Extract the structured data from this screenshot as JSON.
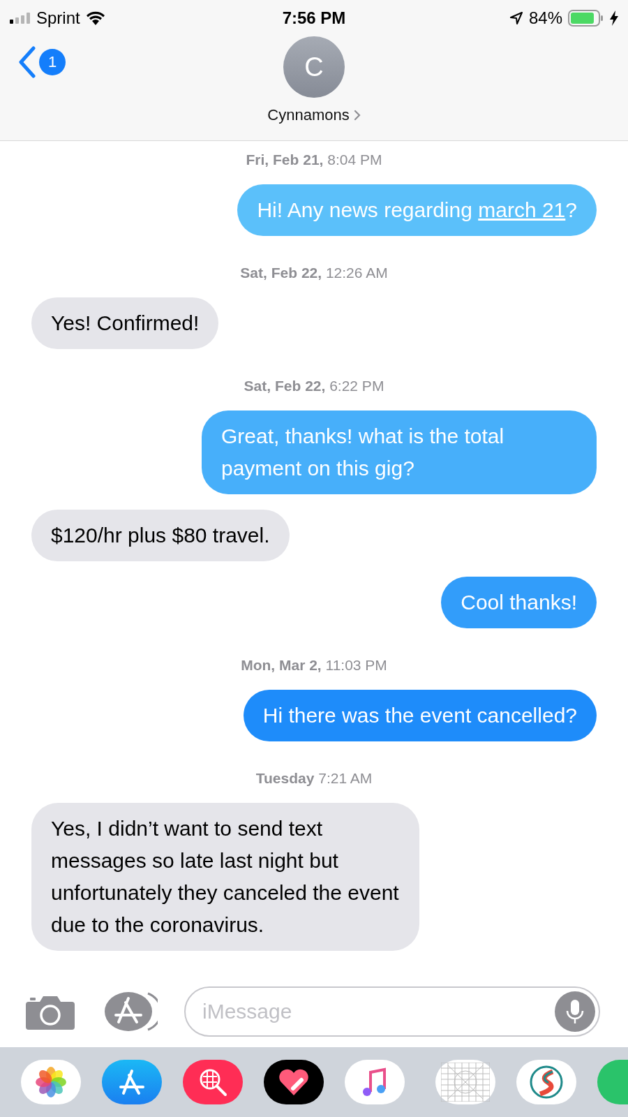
{
  "status_bar": {
    "carrier": "Sprint",
    "time": "7:56 PM",
    "battery": "84%"
  },
  "header": {
    "back_badge": "1",
    "avatar_letter": "C",
    "contact_name": "Cynnamons"
  },
  "conversation": [
    {
      "kind": "timestamp",
      "text": "**Fri, Feb 21,** 8:04 PM"
    },
    {
      "kind": "sent",
      "parts": [
        {
          "kind": "plain",
          "text": "Hi! Any news regarding "
        },
        {
          "kind": "link",
          "text": "march 21"
        },
        {
          "kind": "plain",
          "text": "?"
        }
      ]
    },
    {
      "kind": "timestamp",
      "text": "**Sat, Feb 22,** 12:26 AM"
    },
    {
      "kind": "received",
      "parts": [
        {
          "kind": "plain",
          "text": "Yes! Confirmed!"
        }
      ]
    },
    {
      "kind": "timestamp",
      "text": "**Sat, Feb 22,** 6:22 PM"
    },
    {
      "kind": "sent",
      "parts": [
        {
          "kind": "plain",
          "text": "Great, thanks! what is the total payment on this gig?"
        }
      ]
    },
    {
      "kind": "received",
      "parts": [
        {
          "kind": "plain",
          "text": "$120/hr plus $80 travel."
        }
      ]
    },
    {
      "kind": "sent",
      "parts": [
        {
          "kind": "plain",
          "text": "Cool thanks!"
        }
      ]
    },
    {
      "kind": "timestamp",
      "text": "**Mon, Mar 2,** 11:03 PM"
    },
    {
      "kind": "sent",
      "parts": [
        {
          "kind": "plain",
          "text": "Hi there was the event cancelled?"
        }
      ]
    },
    {
      "kind": "timestamp",
      "text": "**Tuesday** 7:21 AM"
    },
    {
      "kind": "received",
      "parts": [
        {
          "kind": "plain",
          "text": "Yes, I didn’t want to send text messages so late last night but unfortunately they canceled the event due to the coronavirus."
        }
      ]
    }
  ],
  "composer": {
    "placeholder": "iMessage"
  }
}
